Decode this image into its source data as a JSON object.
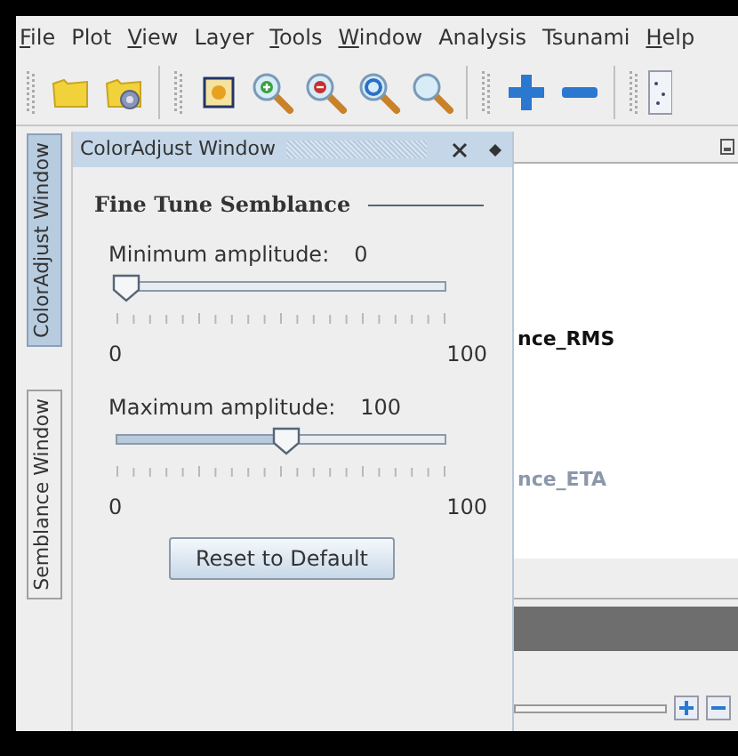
{
  "menu": [
    {
      "label": "File",
      "mnemonic": true
    },
    {
      "label": "Plot",
      "mnemonic": false
    },
    {
      "label": "View",
      "mnemonic": true
    },
    {
      "label": "Layer",
      "mnemonic": false
    },
    {
      "label": "Tools",
      "mnemonic": true
    },
    {
      "label": "Window",
      "mnemonic": true
    },
    {
      "label": "Analysis",
      "mnemonic": false
    },
    {
      "label": "Tsunami",
      "mnemonic": false
    },
    {
      "label": "Help",
      "mnemonic": true
    }
  ],
  "side_tabs": [
    {
      "label": "ColorAdjust Window",
      "selected": true
    },
    {
      "label": "Semblance Window",
      "selected": false
    }
  ],
  "panel": {
    "title": "ColorAdjust Window",
    "section_title": "Fine Tune Semblance",
    "sliders": [
      {
        "label": "Minimum amplitude:",
        "reading": "0",
        "level": 0,
        "min_label": "0",
        "max_label": "100"
      },
      {
        "label": "Maximum amplitude:",
        "reading": "100",
        "level": 0.51,
        "min_label": "0",
        "max_label": "100"
      }
    ],
    "reset_button": "Reset to Default"
  },
  "background_list": [
    {
      "text": "nce_RMS",
      "disabled": false
    },
    {
      "text": "nce_ETA",
      "disabled": true
    }
  ]
}
